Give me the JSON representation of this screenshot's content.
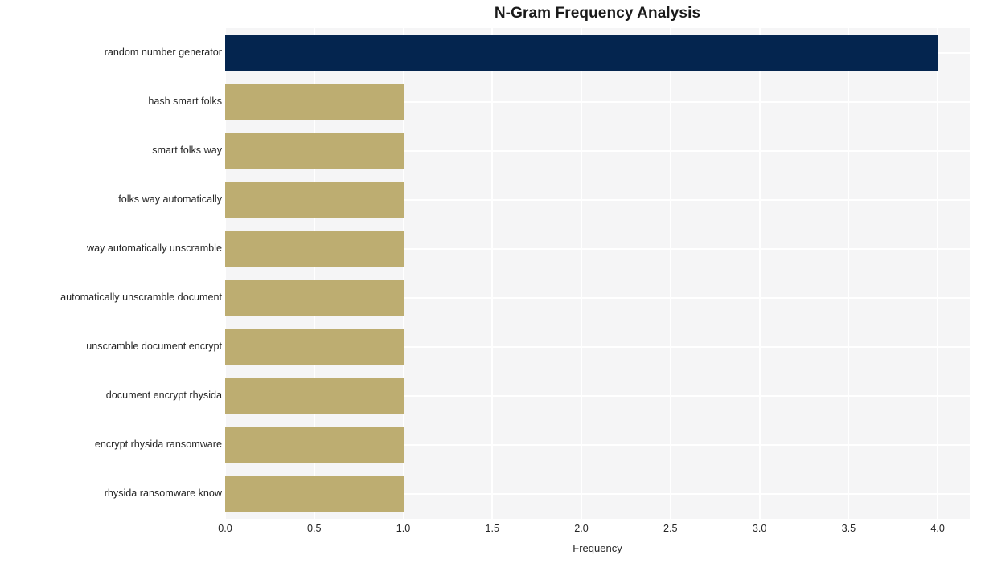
{
  "chart_data": {
    "type": "bar",
    "orientation": "horizontal",
    "title": "N-Gram Frequency Analysis",
    "xlabel": "Frequency",
    "ylabel": "",
    "categories": [
      "random number generator",
      "hash smart folks",
      "smart folks way",
      "folks way automatically",
      "way automatically unscramble",
      "automatically unscramble document",
      "unscramble document encrypt",
      "document encrypt rhysida",
      "encrypt rhysida ransomware",
      "rhysida ransomware know"
    ],
    "values": [
      4,
      1,
      1,
      1,
      1,
      1,
      1,
      1,
      1,
      1
    ],
    "bar_colors": [
      "#04254f",
      "#bdad71",
      "#bdad71",
      "#bdad71",
      "#bdad71",
      "#bdad71",
      "#bdad71",
      "#bdad71",
      "#bdad71",
      "#bdad71"
    ],
    "xlim": [
      0,
      4.18
    ],
    "xticks": [
      0.0,
      0.5,
      1.0,
      1.5,
      2.0,
      2.5,
      3.0,
      3.5,
      4.0
    ],
    "xtick_labels": [
      "0.0",
      "0.5",
      "1.0",
      "1.5",
      "2.0",
      "2.5",
      "3.0",
      "3.5",
      "4.0"
    ],
    "grid": true,
    "legend": null,
    "plot_background": "#f5f5f6",
    "figure_background": "#ffffff",
    "grid_color": "#ffffff",
    "title_color": "#1a1a1a",
    "tick_label_color": "#262626"
  }
}
